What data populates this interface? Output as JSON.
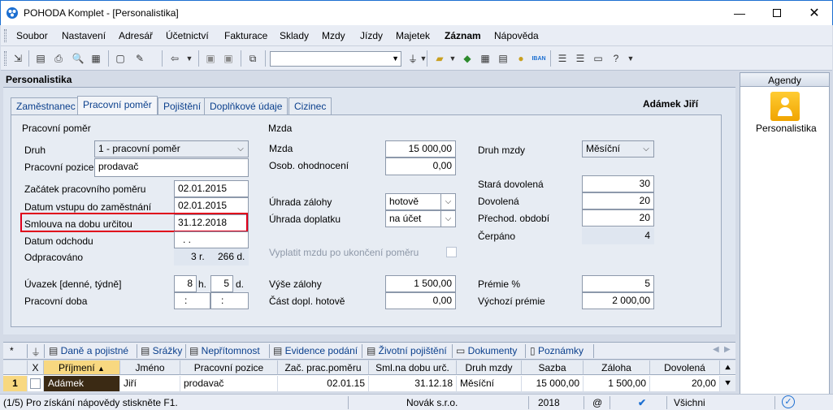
{
  "window": {
    "title": "POHODA Komplet - [Personalistika]"
  },
  "menu": [
    "Soubor",
    "Nastavení",
    "Adresář",
    "Účetnictví",
    "Fakturace",
    "Sklady",
    "Mzdy",
    "Jízdy",
    "Majetek",
    "Záznam",
    "Nápověda"
  ],
  "panel": {
    "title": "Personalistika"
  },
  "agendy": {
    "header": "Agendy",
    "item": "Personalistika"
  },
  "tabs": [
    "Zaměstnanec",
    "Pracovní poměr",
    "Pojištění",
    "Doplňkové údaje",
    "Cizinec"
  ],
  "employee_name": "Adámek Jiří",
  "pracovni_pomer": {
    "section": "Pracovní poměr",
    "druh_label": "Druh",
    "druh_value": "1 - pracovní poměr",
    "pozice_label": "Pracovní pozice",
    "pozice_value": "prodavač",
    "zacatek_label": "Začátek pracovního poměru",
    "zacatek_value": "02.01.2015",
    "vstup_label": "Datum vstupu do zaměstnání",
    "vstup_value": "02.01.2015",
    "smlouva_label": "Smlouva na dobu určitou",
    "smlouva_value": "31.12.2018",
    "odchod_label": "Datum odchodu",
    "odchod_value": ". .",
    "odpracovano_label": "Odpracováno",
    "odpracovano_r": "3 r.",
    "odpracovano_d": "266 d.",
    "uvazek_label": "Úvazek [denné, týdně]",
    "uvazek_h_val": "8",
    "uvazek_h": "h.",
    "uvazek_d_val": "5",
    "uvazek_d": "d.",
    "doba_label": "Pracovní doba",
    "doba_from": ":",
    "doba_to": ":"
  },
  "mzda": {
    "section": "Mzda",
    "mzda_label": "Mzda",
    "mzda_value": "15 000,00",
    "osob_label": "Osob. ohodnocení",
    "osob_value": "0,00",
    "uhrada_zalohy_label": "Úhrada zálohy",
    "uhrada_zalohy_value": "hotově",
    "uhrada_doplatku_label": "Úhrada doplatku",
    "uhrada_doplatku_value": "na účet",
    "vyplatit_label": "Vyplatit mzdu po ukončení poměru",
    "vyse_zalohy_label": "Výše zálohy",
    "vyse_zalohy_value": "1 500,00",
    "cast_label": "Část dopl. hotově",
    "cast_value": "0,00",
    "druh_mzdy_label": "Druh mzdy",
    "druh_mzdy_value": "Měsíční",
    "stara_label": "Stará dovolená",
    "stara_value": "30",
    "dovolena_label": "Dovolená",
    "dovolena_value": "20",
    "prechod_label": "Přechod. období",
    "prechod_value": "20",
    "cerpano_label": "Čerpáno",
    "cerpano_value": "4",
    "premie_label": "Prémie %",
    "premie_value": "5",
    "vychozi_label": "Výchozí prémie",
    "vychozi_value": "2 000,00"
  },
  "bottom_tabs": [
    "*",
    "Daně a pojistné",
    "Srážky",
    "Nepřítomnost",
    "Evidence podání",
    "Životní pojištění",
    "Dokumenty",
    "Poznámky"
  ],
  "grid": {
    "headers": [
      "X",
      "Příjmení",
      "Jméno",
      "Pracovní pozice",
      "Zač. prac.poměru",
      "Sml.na dobu urč.",
      "Druh mzdy",
      "Sazba",
      "Záloha",
      "Dovolená"
    ],
    "row": {
      "num": "1",
      "prijmeni": "Adámek",
      "jmeno": "Jiří",
      "pozice": "prodavač",
      "zac": "02.01.15",
      "sml": "31.12.18",
      "druh": "Měsíční",
      "sazba": "15 000,00",
      "zaloha": "1 500,00",
      "dovolena": "20,00"
    }
  },
  "status": {
    "text": "(1/5) Pro získání nápovědy stiskněte F1.",
    "company": "Novák s.r.o.",
    "year": "2018",
    "at": "@",
    "filter": "Všichni"
  },
  "colors": {
    "accent": "#1c6fd1",
    "highlight": "#e0001b",
    "selected_cell": "#3b2a14"
  }
}
